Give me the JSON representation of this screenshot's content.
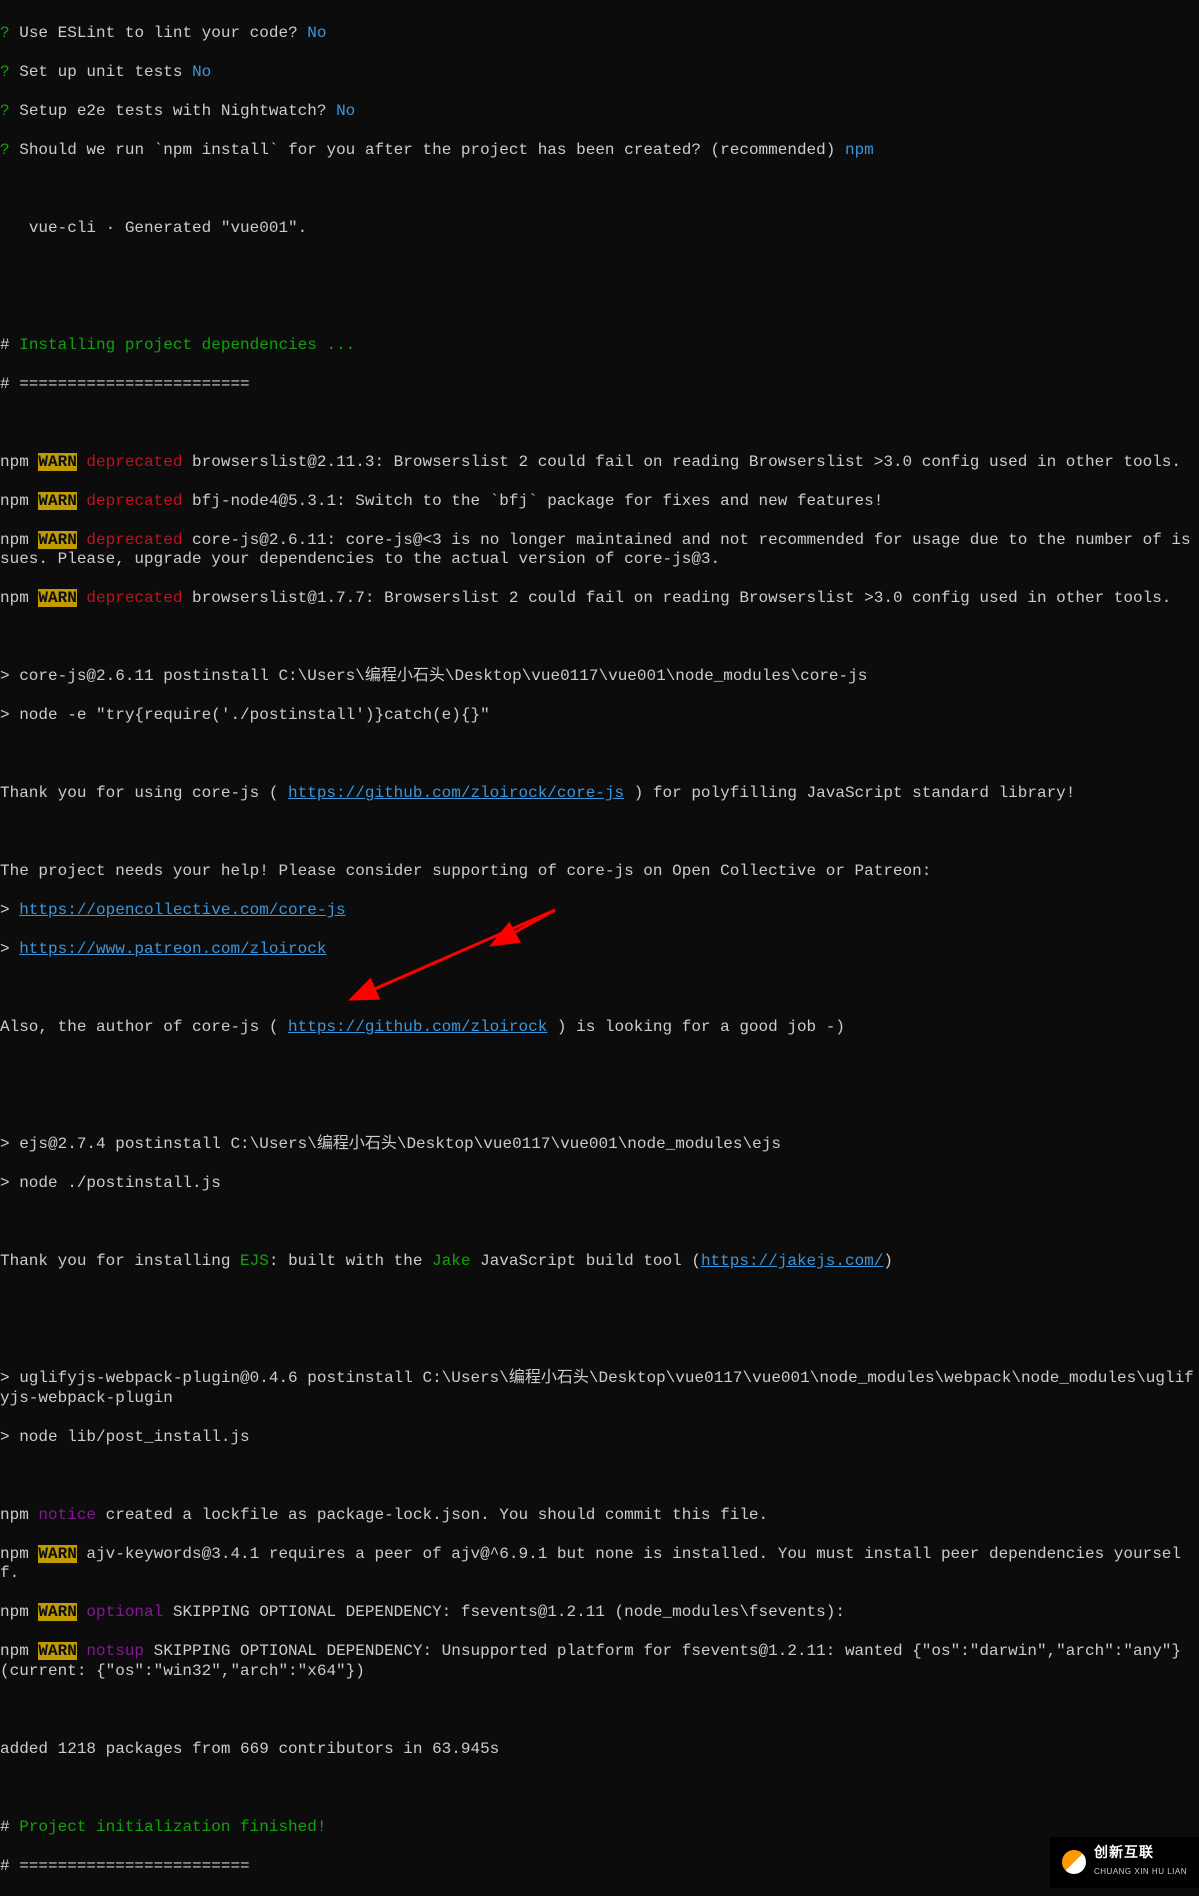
{
  "prompts": [
    {
      "q": "Use ESLint to lint your code?",
      "a": "No"
    },
    {
      "q": "Set up unit tests",
      "a": "No"
    },
    {
      "q": "Setup e2e tests with Nightwatch?",
      "a": "No"
    },
    {
      "q": "Should we run `npm install` for you after the project has been created? (recommended)",
      "a": "npm"
    }
  ],
  "generated_line": "   vue-cli · Generated \"vue001\".",
  "hash1": "#",
  "install_deps": " Installing project dependencies ...",
  "hash_sep": "# ========================",
  "warns": [
    {
      "prefix": "npm ",
      "tag": "WARN",
      "kw": " deprecated",
      "msg": " browserslist@2.11.3: Browserslist 2 could fail on reading Browserslist >3.0 config used in other tools."
    },
    {
      "prefix": "npm ",
      "tag": "WARN",
      "kw": " deprecated",
      "msg": " bfj-node4@5.3.1: Switch to the `bfj` package for fixes and new features!"
    },
    {
      "prefix": "npm ",
      "tag": "WARN",
      "kw": " deprecated",
      "msg": " core-js@2.6.11: core-js@<3 is no longer maintained and not recommended for usage due to the number of issues. Please, upgrade your dependencies to the actual version of core-js@3."
    },
    {
      "prefix": "npm ",
      "tag": "WARN",
      "kw": " deprecated",
      "msg": " browserslist@1.7.7: Browserslist 2 could fail on reading Browserslist >3.0 config used in other tools."
    }
  ],
  "postinstall1": {
    "l1": "> core-js@2.6.11 postinstall C:\\Users\\编程小石头\\Desktop\\vue0117\\vue001\\node_modules\\core-js",
    "l2": "> node -e \"try{require('./postinstall')}catch(e){}\""
  },
  "thanks1": {
    "pre": "Thank you for using core-js ( ",
    "link": "https://github.com/zloirock/core-js",
    "post": " ) for polyfilling JavaScript standard library!"
  },
  "support": "The project needs your help! Please consider supporting of core-js on Open Collective or Patreon:",
  "support_links": [
    {
      "gt": "> ",
      "url": "https://opencollective.com/core-js"
    },
    {
      "gt": "> ",
      "url": "https://www.patreon.com/zloirock"
    }
  ],
  "also": {
    "pre": "Also, the author of core-js ( ",
    "link": "https://github.com/zloirock",
    "post": " ) is looking for a good job -)"
  },
  "postinstall2": {
    "l1": "> ejs@2.7.4 postinstall C:\\Users\\编程小石头\\Desktop\\vue0117\\vue001\\node_modules\\ejs",
    "l2": "> node ./postinstall.js"
  },
  "thanks2": {
    "pre": "Thank you for installing ",
    "ejs": "EJS",
    "mid": ": built with the ",
    "jake": "Jake",
    "mid2": " JavaScript build tool (",
    "link": "https://jakejs.com/",
    "post": ")"
  },
  "postinstall3": {
    "l1": "> uglifyjs-webpack-plugin@0.4.6 postinstall C:\\Users\\编程小石头\\Desktop\\vue0117\\vue001\\node_modules\\webpack\\node_modules\\uglifyjs-webpack-plugin",
    "l2": "> node lib/post_install.js"
  },
  "notice": {
    "prefix": "npm ",
    "tag": "notice",
    "msg": " created a lockfile as package-lock.json. You should commit this file."
  },
  "warns2": [
    {
      "prefix": "npm ",
      "tag": "WARN",
      "kw": "",
      "msg": " ajv-keywords@3.4.1 requires a peer of ajv@^6.9.1 but none is installed. You must install peer dependencies yourself."
    },
    {
      "prefix": "npm ",
      "tag": "WARN",
      "kw": " optional",
      "msg": " SKIPPING OPTIONAL DEPENDENCY: fsevents@1.2.11 (node_modules\\fsevents):"
    },
    {
      "prefix": "npm ",
      "tag": "WARN",
      "kw": " notsup",
      "msg": " SKIPPING OPTIONAL DEPENDENCY: Unsupported platform for fsevents@1.2.11: wanted {\"os\":\"darwin\",\"arch\":\"any\"} (current: {\"os\":\"win32\",\"arch\":\"x64\"})"
    }
  ],
  "added": "added 1218 packages from 669 contributors in 63.945s",
  "finish": {
    "hash": "#",
    "msg": " Project initialization finished!"
  },
  "hash_sep2": "# ========================",
  "watermark": {
    "cn": "创新互联",
    "en": "CHUANG XIN HU LIAN"
  }
}
